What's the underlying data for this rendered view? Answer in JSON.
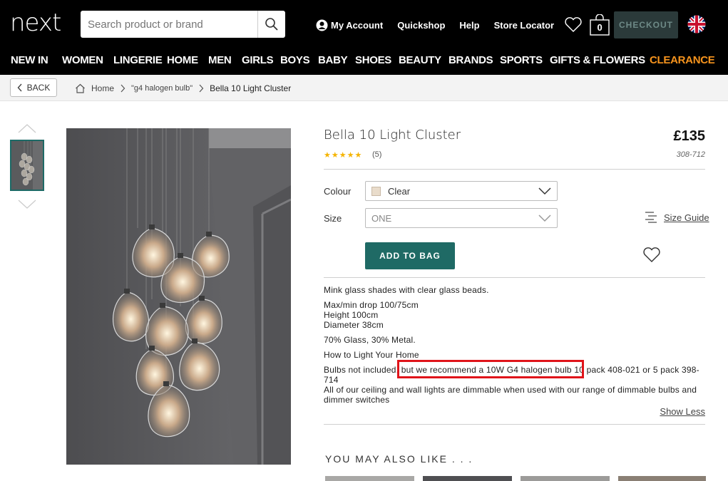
{
  "header": {
    "logo": "next",
    "search_placeholder": "Search product or brand",
    "links": {
      "my_account": "My Account",
      "quickshop": "Quickshop",
      "help": "Help",
      "store_locator": "Store Locator"
    },
    "bag_count": "0",
    "checkout_label": "CHECKOUT"
  },
  "nav": {
    "items": [
      "NEW IN",
      "WOMEN",
      "LINGERIE",
      "HOME",
      "MEN",
      "GIRLS",
      "BOYS",
      "BABY",
      "SHOES",
      "BEAUTY",
      "BRANDS",
      "SPORTS",
      "GIFTS & FLOWERS",
      "CLEARANCE"
    ],
    "accent_color": "#f7941d"
  },
  "breadcrumb": {
    "back_label": "BACK",
    "home": "Home",
    "search_term": "\"g4 halogen bulb\"",
    "current": "Bella 10 Light Cluster"
  },
  "product": {
    "title": "Bella 10 Light Cluster",
    "price": "£135",
    "stars": "★★★★★",
    "review_count": "(5)",
    "code": "308-712",
    "colour_label": "Colour",
    "colour_value": "Clear",
    "size_label": "Size",
    "size_value": "ONE",
    "size_guide": "Size Guide",
    "add_to_bag": "ADD TO BAG",
    "brand_color": "#1f6a65"
  },
  "description": {
    "line1": "Mink glass shades with clear glass beads.",
    "line2": "Max/min drop 100/75cm",
    "line3": "Height 100cm",
    "line4": "Diameter 38cm",
    "line5": "70% Glass, 30% Metal.",
    "line6": "How to Light Your Home",
    "line7": "Bulbs not included, but we recommend a 10W G4 halogen bulb 10 pack 408-021 or 5 pack 398-714",
    "line8": "All of our ceiling and wall lights are dimmable when used with our range of dimmable bulbs and dimmer switches",
    "show_less": "Show Less"
  },
  "recommendations": {
    "heading": "YOU MAY ALSO LIKE . . ."
  }
}
